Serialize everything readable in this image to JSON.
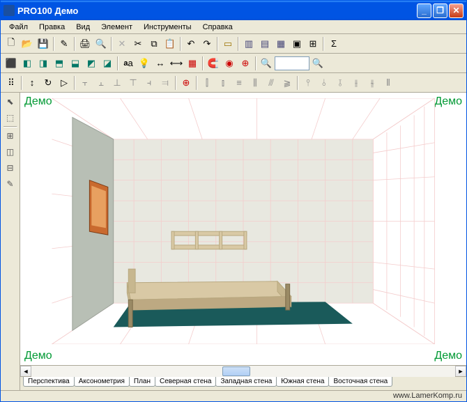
{
  "window": {
    "title": "PRO100 Демо"
  },
  "menu": {
    "items": [
      "Файл",
      "Правка",
      "Вид",
      "Элемент",
      "Инструменты",
      "Справка"
    ]
  },
  "viewport": {
    "watermark": "Демо",
    "perspective_grid": true
  },
  "tabs": {
    "items": [
      "Перспектива",
      "Аксонометрия",
      "План",
      "Северная стена",
      "Западная стена",
      "Южная стена",
      "Восточная стена"
    ],
    "active": 0
  },
  "footer": {
    "url": "www.LamerKomp.ru"
  },
  "icons": {
    "new": "🗋",
    "open": "📂",
    "save": "💾",
    "edit": "✎",
    "print": "🖨",
    "preview": "🔍",
    "cut": "✂",
    "copy": "⧉",
    "paste": "📋",
    "undo": "↶",
    "redo": "↷",
    "sigma": "Σ",
    "light": "💡",
    "grid": "▦",
    "magnet": "🧲",
    "target": "◎",
    "zoom": "🔍",
    "arrow": "↖",
    "cursor": "⬉"
  }
}
